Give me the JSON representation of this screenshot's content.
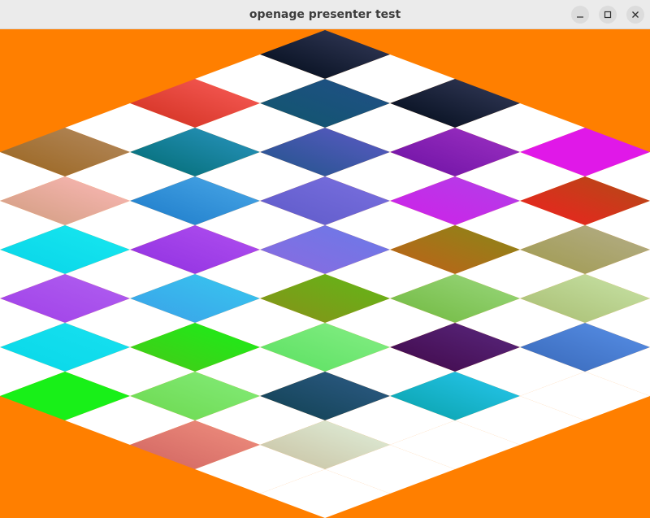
{
  "window": {
    "title": "openage presenter test",
    "controls": {
      "minimize_icon": "minimize-icon",
      "maximize_icon": "maximize-icon",
      "close_icon": "close-icon"
    }
  },
  "canvas": {
    "background_color": "#ff7f00",
    "gap_color": "#ffffff",
    "grid_size": 10,
    "tile_gradients": {
      "0,0": [
        "#000a18",
        "#363c5c"
      ],
      "0,2": [
        "#cf2e1e",
        "#fa5e5a"
      ],
      "0,4": [
        "#99641d",
        "#b48a60"
      ],
      "0,6": [
        "#609a0e",
        "#86bb52"
      ],
      "0,8": [
        "#38d81a",
        "#56e15e"
      ],
      "1,1": [
        "#10566c",
        "#214f88"
      ],
      "1,3": [
        "#006a70",
        "#2b96c2"
      ],
      "1,5": [
        "#cf9c7e",
        "#fdb9b8"
      ],
      "1,7": [
        "#84c45a",
        "#c1f0b6"
      ],
      "1,9": [
        "#6c10a2",
        "#9e32c4"
      ],
      "2,0": [
        "#000a18",
        "#363c5c"
      ],
      "2,2": [
        "#205488",
        "#5e5ac8"
      ],
      "2,4": [
        "#1c7ac8",
        "#4aa8e8"
      ],
      "2,6": [
        "#08d4e8",
        "#18e8f0"
      ],
      "2,8": [
        "#e010e8",
        "#c040f0"
      ],
      "3,1": [
        "#6c10a2",
        "#9e32c4"
      ],
      "3,3": [
        "#5e5ac8",
        "#7a70e0"
      ],
      "3,5": [
        "#9030e0",
        "#b050f0"
      ],
      "3,7": [
        "#a040e8",
        "#b060f0"
      ],
      "3,9": [
        "#b02090",
        "#d040e0"
      ],
      "4,0": [
        "#e018e8",
        "#e018e8"
      ],
      "4,2": [
        "#d020e8",
        "#b040e8"
      ],
      "4,4": [
        "#8a6ae0",
        "#6a7ae8"
      ],
      "4,6": [
        "#3aa0e8",
        "#38c8f0"
      ],
      "4,8": [
        "#08d8e8",
        "#18e0f0"
      ],
      "5,1": [
        "#f02020",
        "#b04c16"
      ],
      "5,3": [
        "#c06018",
        "#888818"
      ],
      "5,5": [
        "#889018",
        "#60b818"
      ],
      "5,7": [
        "#48c818",
        "#18f018"
      ],
      "5,9": [
        "#18f018",
        "#18f018"
      ],
      "6,0": [
        "#cf6846",
        "#ee8f82"
      ],
      "6,2": [
        "#a09a4e",
        "#b4ae8a"
      ],
      "6,4": [
        "#70b83e",
        "#9ad87e"
      ],
      "6,6": [
        "#5ae060",
        "#86ee86"
      ],
      "6,8": [
        "#6cd84e",
        "#84ec7a"
      ],
      "7,1": [
        "#c8c090",
        "#dceccc"
      ],
      "7,3": [
        "#a8bc70",
        "#c8e4a8"
      ],
      "7,5": [
        "#400848",
        "#5a2880"
      ],
      "7,7": [
        "#104050",
        "#2e5c88"
      ],
      "7,9": [
        "#d06460",
        "#f09080"
      ],
      "8,0": [
        "#a818c8",
        "#c030e8"
      ],
      "8,2": [
        "#6848c8",
        "#8a60e8"
      ],
      "8,4": [
        "#3868b8",
        "#5890e8"
      ],
      "8,6": [
        "#08a0a8",
        "#28c8f0"
      ],
      "8,8": [
        "#c8c0a0",
        "#e0f0dc"
      ],
      "9,1": [
        "#ffffff",
        "#ffffff"
      ],
      "9,3": [
        "#ffffff",
        "#ffffff"
      ],
      "9,5": [
        "#ffffff",
        "#ffffff"
      ],
      "9,7": [
        "#ffffff",
        "#ffffff"
      ],
      "9,9": [
        "#ffffff",
        "#ffffff"
      ]
    }
  }
}
